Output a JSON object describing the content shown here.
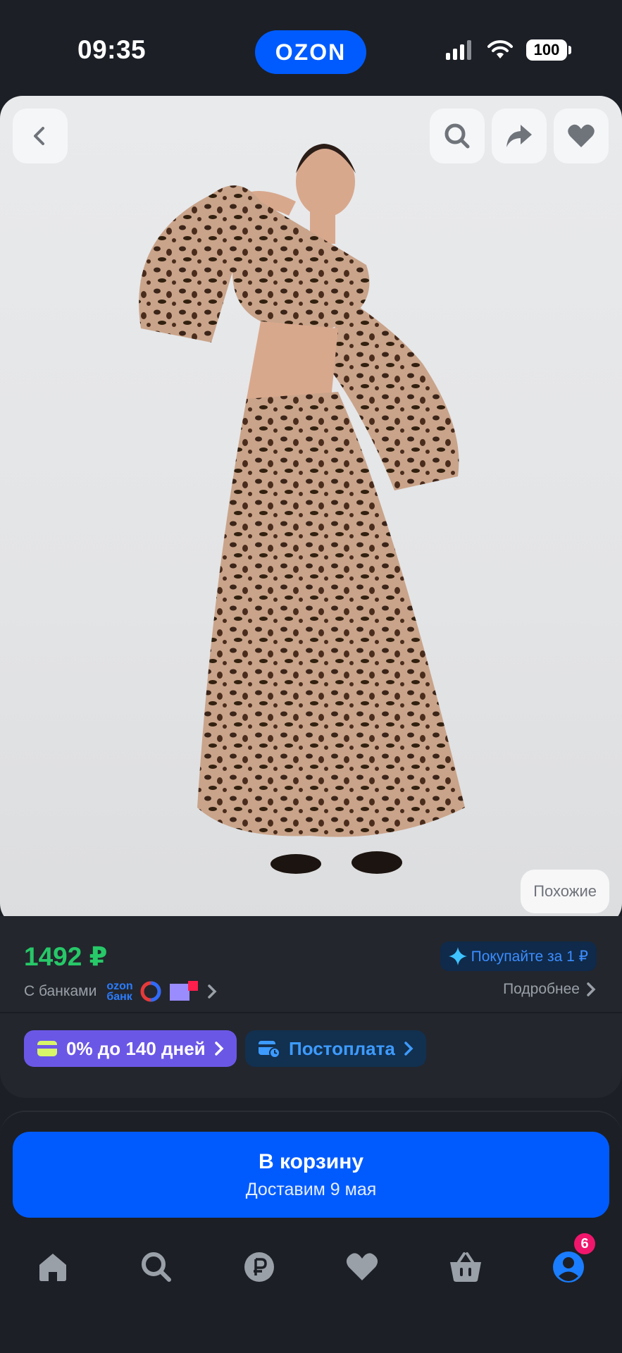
{
  "status_bar": {
    "time": "09:35",
    "brand": "OZON",
    "battery": "100"
  },
  "product": {
    "similar_label": "Похожие"
  },
  "card": {
    "price": "1492 ₽",
    "promo": "Покупайте за 1 ₽",
    "banks_label": "С банками",
    "bank_logo_line1": "ozon",
    "bank_logo_line2": "банк",
    "more_label": "Подробнее",
    "installment_label": "0% до 140 дней",
    "postpay_label": "Постоплата"
  },
  "cart": {
    "title": "В корзину",
    "subtitle": "Доставим 9 мая"
  },
  "tabbar": {
    "profile_badge": "6"
  },
  "colors": {
    "accent": "#005bff",
    "price_green": "#27c868",
    "badge_pink": "#f0166b",
    "installment_purple": "#6b57e6"
  },
  "icons": [
    "back-icon",
    "search-icon",
    "share-icon",
    "heart-icon",
    "home-icon",
    "ruble-icon",
    "basket-icon",
    "profile-icon"
  ]
}
